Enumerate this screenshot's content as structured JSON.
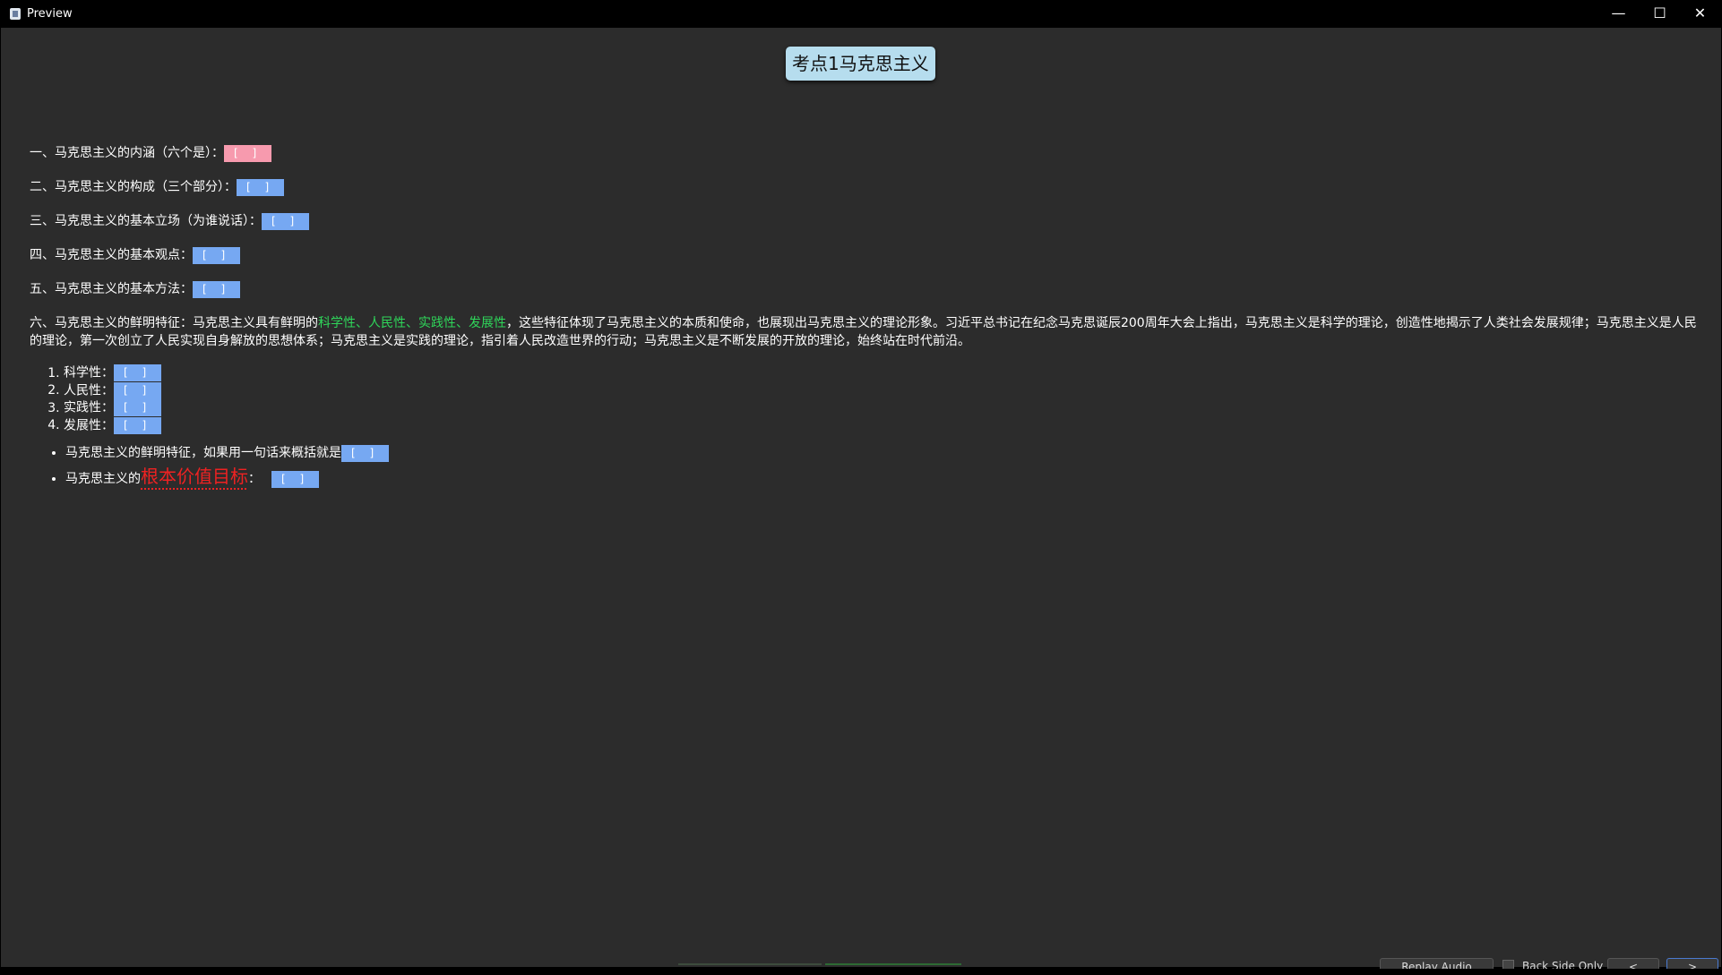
{
  "window": {
    "title": "Preview",
    "minimize_glyph": "—",
    "maximize_glyph": "☐",
    "close_glyph": "✕",
    "icon": "preview-app-icon"
  },
  "card": {
    "title": "考点1马克思主义",
    "questions": [
      {
        "text": "一、马克思主义的内涵（六个是）：",
        "cloze": "[ ]"
      },
      {
        "text": "二、马克思主义的构成（三个部分）：",
        "cloze": "[ ]"
      },
      {
        "text": "三、马克思主义的基本立场（为谁说话）：",
        "cloze": "[ ]"
      },
      {
        "text": "四、马克思主义的基本观点：",
        "cloze": "[ ]"
      },
      {
        "text": "五、马克思主义的基本方法：",
        "cloze": "[ ]"
      }
    ],
    "paragraph": {
      "prefix": "六、马克思主义的鲜明特征：马克思主义具有鲜明的",
      "highlight": "科学性、人民性、实践性、发展性",
      "suffix": "，这些特征体现了马克思主义的本质和使命，也展现出马克思主义的理论形象。习近平总书记在纪念马克思诞辰200周年大会上指出，马克思主义是科学的理论，创造性地揭示了人类社会发展规律；马克思主义是人民的理论，第一次创立了人民实现自身解放的思想体系；马克思主义是实践的理论，指引着人民改造世界的行动；马克思主义是不断发展的开放的理论，始终站在时代前沿。"
    },
    "ordered": [
      {
        "label": "科学性：",
        "cloze": "[ ]"
      },
      {
        "label": "人民性：",
        "cloze": "[ ]"
      },
      {
        "label": "实践性：",
        "cloze": "[ ]"
      },
      {
        "label": "发展性：",
        "cloze": "[ ]"
      }
    ],
    "bullets": {
      "b1_text": "马克思主义的鲜明特征，如果用一句话来概括就是",
      "b1_cloze": "[ ]",
      "b2_prefix": "马克思主义的",
      "b2_emphasis": "根本价值目标",
      "b2_colon": "：",
      "b2_cloze": "[ ]"
    }
  },
  "bottom": {
    "replay_audio": "Replay Audio",
    "back_side_only": "Back Side Only",
    "prev": "<",
    "next": ">"
  },
  "colors": {
    "cloze_blue": "#76a8f2",
    "cloze_pink": "#f79aae",
    "highlight_green": "#2fd65a",
    "emphasis_red": "#ee2222",
    "title_bg": "#b6ddee"
  }
}
